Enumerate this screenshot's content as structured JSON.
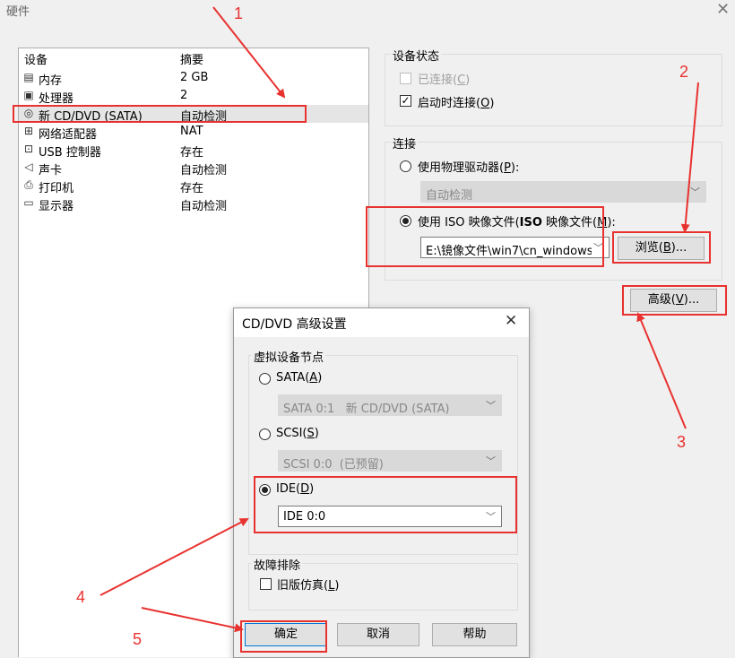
{
  "window": {
    "title": "硬件",
    "close_glyph": "✕"
  },
  "device_list": {
    "col_device": "设备",
    "col_summary": "摘要",
    "rows": [
      {
        "name": "内存",
        "summary": "2 GB",
        "icon": "memory-icon"
      },
      {
        "name": "处理器",
        "summary": "2",
        "icon": "processor-icon"
      },
      {
        "name": "新 CD/DVD (SATA)",
        "summary": "自动检测",
        "icon": "cd-dvd-icon"
      },
      {
        "name": "网络适配器",
        "summary": "NAT",
        "icon": "network-adapter-icon"
      },
      {
        "name": "USB 控制器",
        "summary": "存在",
        "icon": "usb-icon"
      },
      {
        "name": "声卡",
        "summary": "自动检测",
        "icon": "sound-card-icon"
      },
      {
        "name": "打印机",
        "summary": "存在",
        "icon": "printer-icon"
      },
      {
        "name": "显示器",
        "summary": "自动检测",
        "icon": "monitor-icon"
      }
    ]
  },
  "device_status": {
    "title": "设备状态",
    "connected_pre": "已连接(",
    "connected_key": "C",
    "connected_post": ")",
    "connect_at_power_on_pre": "启动时连接(",
    "connect_at_power_on_key": "O",
    "connect_at_power_on_post": ")"
  },
  "connection": {
    "title": "连接",
    "physical_pre": "使用物理驱动器(",
    "physical_key": "P",
    "physical_post": "):",
    "physical_select": "自动检测",
    "iso_pre": "使用 ISO 映像文件(",
    "iso_key": "M",
    "iso_post": "):",
    "iso_path": "E:\\镜像文件\\win7\\cn_windows",
    "browse_pre": "浏览(",
    "browse_key": "B",
    "browse_post": ")..."
  },
  "advanced_button": {
    "pre": "高级(",
    "key": "V",
    "post": ")..."
  },
  "dialog": {
    "title": "CD/DVD 高级设置",
    "node_group": "虚拟设备节点",
    "sata_pre": "SATA(",
    "sata_key": "A",
    "sata_post": ")",
    "sata_select": "SATA 0:1   新 CD/DVD (SATA)",
    "scsi_pre": "SCSI(",
    "scsi_key": "S",
    "scsi_post": ")",
    "scsi_select": "SCSI 0:0  (已预留)",
    "ide_pre": "IDE(",
    "ide_key": "D",
    "ide_post": ")",
    "ide_select": "IDE 0:0",
    "troubleshoot_group": "故障排除",
    "legacy_pre": "旧版仿真(",
    "legacy_key": "L",
    "legacy_post": ")",
    "ok": "确定",
    "cancel": "取消",
    "help": "帮助"
  },
  "annotations": [
    "1",
    "2",
    "3",
    "4",
    "5"
  ],
  "colors": {
    "annotation": "#e8322f"
  }
}
